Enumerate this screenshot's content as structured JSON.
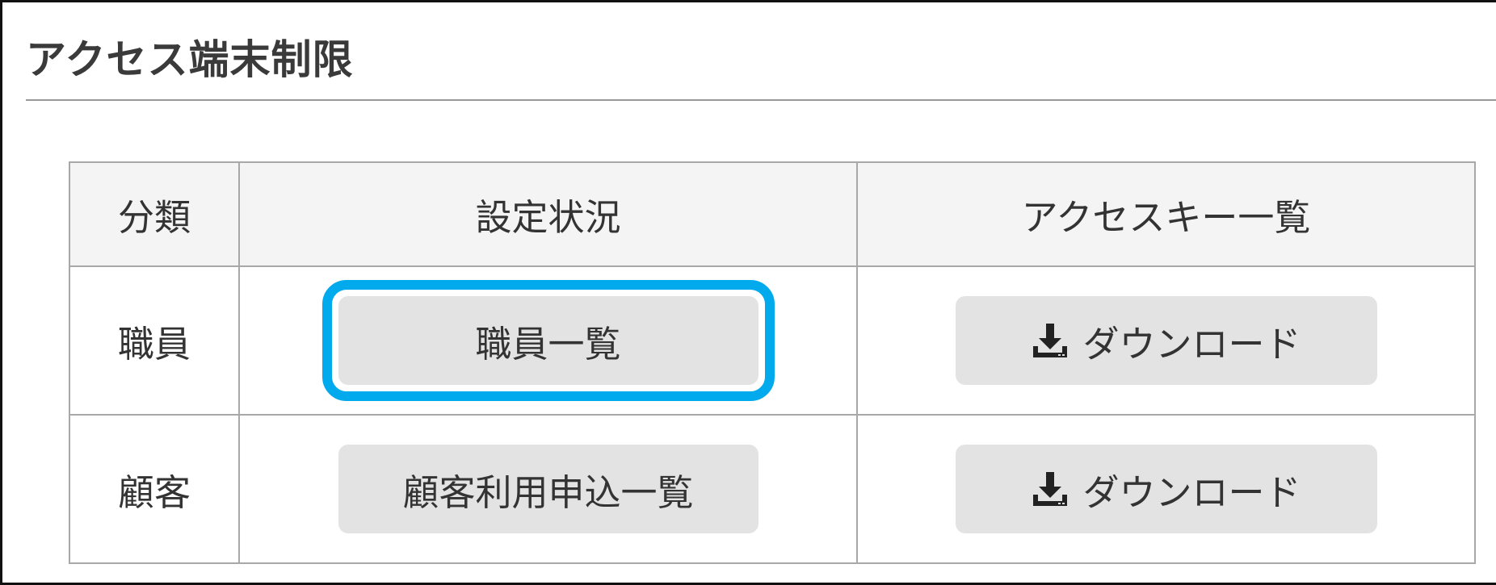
{
  "page": {
    "title": "アクセス端末制限"
  },
  "table": {
    "headers": [
      "分類",
      "設定状況",
      "アクセスキー一覧"
    ],
    "rows": [
      {
        "category": "職員",
        "list_button": "職員一覧",
        "download_button": "ダウンロード",
        "highlighted": true
      },
      {
        "category": "顧客",
        "list_button": "顧客利用申込一覧",
        "download_button": "ダウンロード",
        "highlighted": false
      }
    ]
  },
  "icons": {
    "download": "download-icon"
  },
  "colors": {
    "highlight": "#00aaec",
    "button_bg": "#e3e3e3",
    "header_bg": "#f4f4f4",
    "border": "#a8a8a8"
  }
}
